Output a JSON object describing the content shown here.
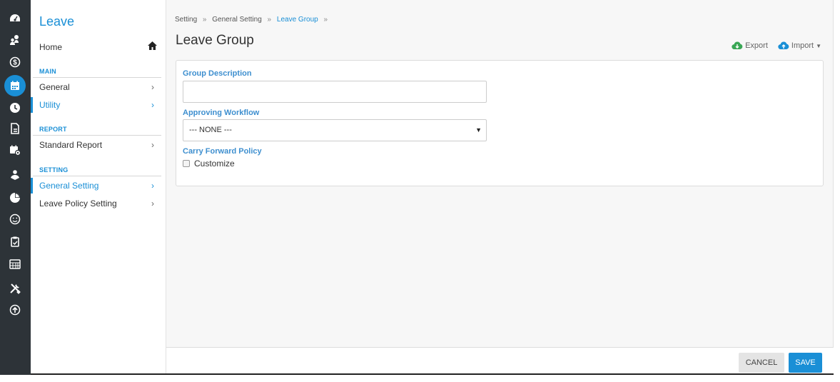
{
  "rail": {
    "icons": [
      "dashboard-icon",
      "user-money-icon",
      "dollar-icon",
      "calendar-icon",
      "clock-icon",
      "document-icon",
      "calendar-settings-icon",
      "people-icon",
      "pie-chart-icon",
      "smile-icon",
      "clipboard-icon",
      "keyboard-icon",
      "tools-icon",
      "upload-icon"
    ],
    "active": "calendar-icon"
  },
  "sidebar": {
    "title": "Leave",
    "home_label": "Home",
    "sections": {
      "main": "MAIN",
      "report": "REPORT",
      "setting": "SETTING"
    },
    "items": {
      "general": "General",
      "utility": "Utility",
      "standard_report": "Standard Report",
      "general_setting": "General Setting",
      "leave_policy_setting": "Leave Policy Setting"
    },
    "chevron": "›"
  },
  "breadcrumb": {
    "setting": "Setting",
    "general_setting": "General Setting",
    "current": "Leave Group",
    "separator": "»"
  },
  "page": {
    "title": "Leave Group",
    "export_label": "Export",
    "import_label": "Import"
  },
  "form": {
    "group_description_label": "Group Description",
    "group_description_value": "",
    "approving_workflow_label": "Approving Workflow",
    "approving_workflow_value": "--- NONE ---",
    "carry_forward_label": "Carry Forward Policy",
    "customize_label": "Customize"
  },
  "footer": {
    "cancel_label": "CANCEL",
    "save_label": "SAVE"
  },
  "colors": {
    "accent": "#1a8fd6",
    "rail_bg": "#2d3338",
    "export_icon": "#3aa655"
  }
}
